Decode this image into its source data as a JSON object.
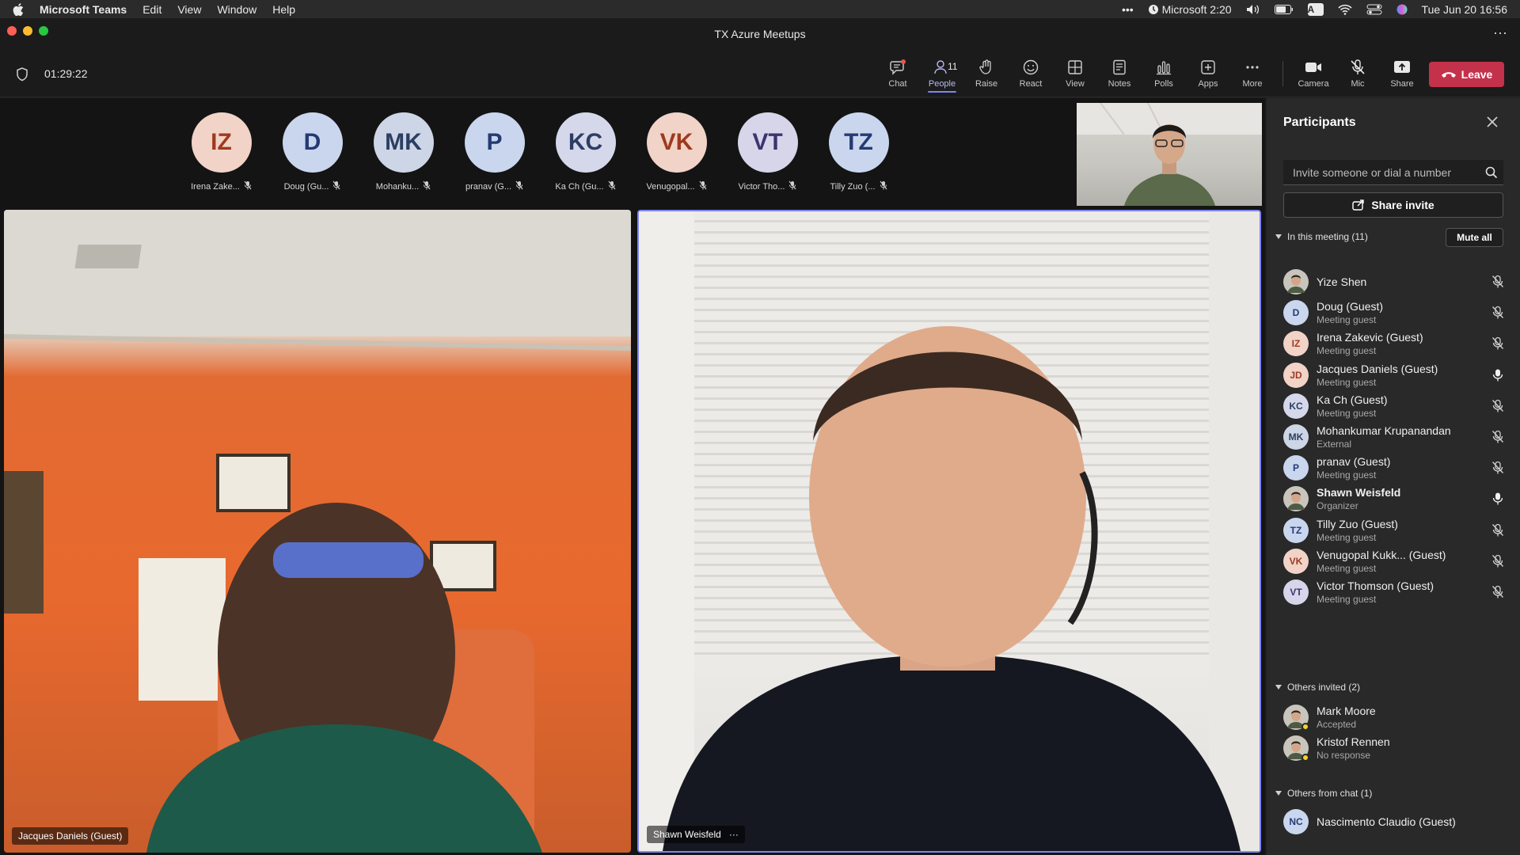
{
  "menubar": {
    "app": "Microsoft Teams",
    "items": [
      "Edit",
      "View",
      "Window",
      "Help"
    ],
    "status_app": "Microsoft",
    "status_time_left": "2:20",
    "input_letter": "A",
    "datetime": "Tue Jun 20  16:56"
  },
  "window": {
    "title": "TX Azure Meetups"
  },
  "toolbar": {
    "timer": "01:29:22",
    "buttons": {
      "chat": "Chat",
      "people": "People",
      "people_count": "11",
      "raise": "Raise",
      "react": "React",
      "view": "View",
      "notes": "Notes",
      "polls": "Polls",
      "apps": "Apps",
      "more": "More",
      "camera": "Camera",
      "mic": "Mic",
      "share": "Share",
      "leave": "Leave"
    }
  },
  "strip": [
    {
      "initials": "IZ",
      "label": "Irena Zake...",
      "bg": "#f1d3c8",
      "fg": "#9e3a1f"
    },
    {
      "initials": "D",
      "label": "Doug (Gu...",
      "bg": "#c9d6ee",
      "fg": "#243a73"
    },
    {
      "initials": "MK",
      "label": "Mohanku...",
      "bg": "#cdd6e6",
      "fg": "#2c3e63"
    },
    {
      "initials": "P",
      "label": "pranav (G...",
      "bg": "#c9d6ee",
      "fg": "#243a73"
    },
    {
      "initials": "KC",
      "label": "Ka Ch (Gu...",
      "bg": "#d4d8ea",
      "fg": "#2c3e63"
    },
    {
      "initials": "VK",
      "label": "Venugopal...",
      "bg": "#f1d3c8",
      "fg": "#9e3a1f"
    },
    {
      "initials": "VT",
      "label": "Victor Tho...",
      "bg": "#d7d5ea",
      "fg": "#3b356e"
    },
    {
      "initials": "TZ",
      "label": "Tilly Zuo (...",
      "bg": "#c9d6ee",
      "fg": "#243a73"
    }
  ],
  "tiles": {
    "left_name": "Jacques Daniels (Guest)",
    "right_name": "Shawn Weisfeld",
    "right_more": "···"
  },
  "panel": {
    "title": "Participants",
    "invite_placeholder": "Invite someone or dial a number",
    "share_invite": "Share invite",
    "in_meeting": "In this meeting (11)",
    "mute_all": "Mute all",
    "others_invited": "Others invited (2)",
    "others_chat": "Others from chat (1)",
    "participants": [
      {
        "name": "Yize Shen",
        "sub": "",
        "initials": "",
        "photo": true,
        "mic": "muted"
      },
      {
        "name": "Doug (Guest)",
        "sub": "Meeting guest",
        "initials": "D",
        "bg": "#c9d6ee",
        "fg": "#243a73",
        "mic": "muted"
      },
      {
        "name": "Irena Zakevic (Guest)",
        "sub": "Meeting guest",
        "initials": "IZ",
        "bg": "#f1d3c8",
        "fg": "#9e3a1f",
        "mic": "muted"
      },
      {
        "name": "Jacques Daniels (Guest)",
        "sub": "Meeting guest",
        "initials": "JD",
        "bg": "#f1d3c8",
        "fg": "#9e3a1f",
        "mic": "on"
      },
      {
        "name": "Ka Ch (Guest)",
        "sub": "Meeting guest",
        "initials": "KC",
        "bg": "#d4d8ea",
        "fg": "#2c3e63",
        "mic": "muted"
      },
      {
        "name": "Mohankumar Krupanandan",
        "sub": "External",
        "initials": "MK",
        "bg": "#cdd6e6",
        "fg": "#2c3e63",
        "mic": "muted"
      },
      {
        "name": "pranav (Guest)",
        "sub": "Meeting guest",
        "initials": "P",
        "bg": "#c9d6ee",
        "fg": "#243a73",
        "mic": "muted"
      },
      {
        "name": "Shawn Weisfeld",
        "sub": "Organizer",
        "initials": "",
        "photo": true,
        "bold": true,
        "mic": "on"
      },
      {
        "name": "Tilly Zuo (Guest)",
        "sub": "Meeting guest",
        "initials": "TZ",
        "bg": "#c9d6ee",
        "fg": "#243a73",
        "mic": "muted"
      },
      {
        "name": "Venugopal Kukk... (Guest)",
        "sub": "Meeting guest",
        "initials": "VK",
        "bg": "#f1d3c8",
        "fg": "#9e3a1f",
        "mic": "muted"
      },
      {
        "name": "Victor Thomson (Guest)",
        "sub": "Meeting guest",
        "initials": "VT",
        "bg": "#d7d5ea",
        "fg": "#3b356e",
        "mic": "muted"
      }
    ],
    "invited": [
      {
        "name": "Mark Moore",
        "sub": "Accepted"
      },
      {
        "name": "Kristof Rennen",
        "sub": "No response"
      }
    ],
    "chat": [
      {
        "name": "Nascimento Claudio (Guest)",
        "initials": "NC",
        "bg": "#c9d6ee",
        "fg": "#243a73"
      }
    ]
  }
}
